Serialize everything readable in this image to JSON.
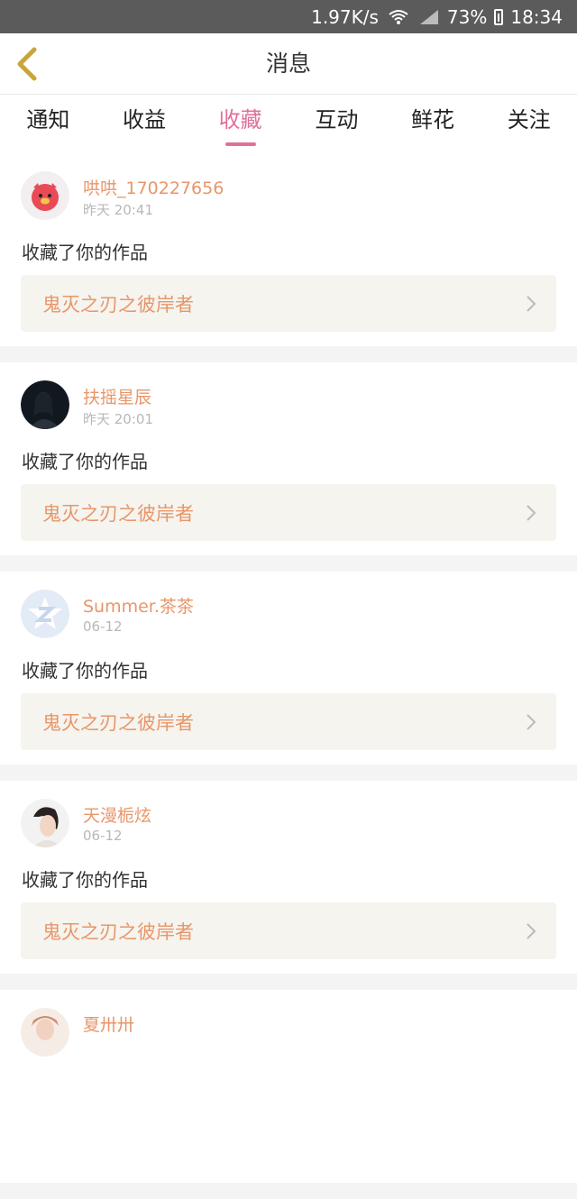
{
  "status_bar": {
    "speed": "1.97K/s",
    "battery": "73%",
    "time": "18:34"
  },
  "header": {
    "title": "消息"
  },
  "tabs": [
    {
      "label": "通知",
      "active": false
    },
    {
      "label": "收益",
      "active": false
    },
    {
      "label": "收藏",
      "active": true
    },
    {
      "label": "互动",
      "active": false
    },
    {
      "label": "鲜花",
      "active": false
    },
    {
      "label": "关注",
      "active": false
    }
  ],
  "colors": {
    "accent": "#e26f9a",
    "username": "#e8966a",
    "link_bg": "#f5f4ee"
  },
  "messages": [
    {
      "username": "哄哄_170227656",
      "time": "昨天 20:41",
      "action": "收藏了你的作品",
      "work": "鬼灭之刃之彼岸者",
      "avatar": "pink-pig-avatar"
    },
    {
      "username": "扶摇星辰",
      "time": "昨天 20:01",
      "action": "收藏了你的作品",
      "work": "鬼灭之刃之彼岸者",
      "avatar": "dark-portrait-avatar"
    },
    {
      "username": "Summer.茶茶",
      "time": "06-12",
      "action": "收藏了你的作品",
      "work": "鬼灭之刃之彼岸者",
      "avatar": "default-z-avatar"
    },
    {
      "username": "天漫栀炫",
      "time": "06-12",
      "action": "收藏了你的作品",
      "work": "鬼灭之刃之彼岸者",
      "avatar": "girl-portrait-avatar"
    },
    {
      "username": "夏卅卅",
      "time": "",
      "action": "",
      "work": "",
      "avatar": "partial-avatar"
    }
  ]
}
